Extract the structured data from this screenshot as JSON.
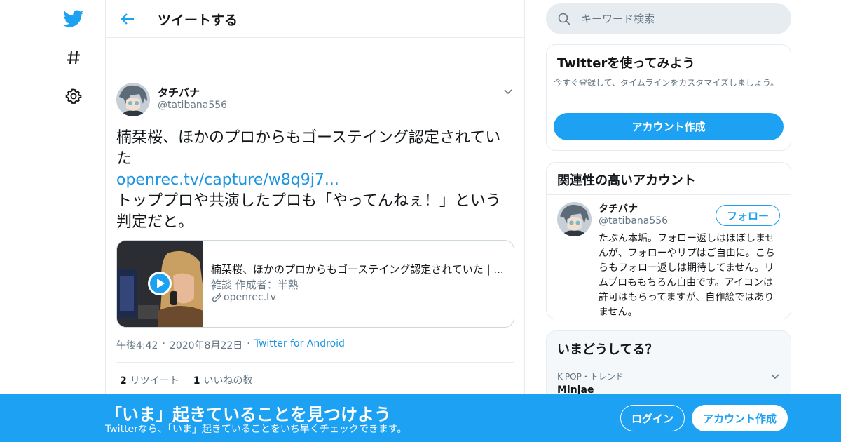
{
  "colors": {
    "accent": "#1da1f2",
    "link": "#1b95e0",
    "secondary_text": "#657786",
    "border": "#e6ecf0"
  },
  "nav": {
    "icons": [
      "twitter-bird-icon",
      "hashtag-icon",
      "gear-icon"
    ]
  },
  "header": {
    "title": "ツイートする"
  },
  "tweet": {
    "author_name": "タチバナ",
    "author_handle": "@tatibana556",
    "text_line1": "楠栞桜、ほかのプロからもゴーステイング認定されていた",
    "link": "openrec.tv/capture/w8q9j7...",
    "text_line2": "トッププロや共演したプロも「やってんねぇ！」という判定だと。",
    "card": {
      "title": "楠栞桜、ほかのプロからもゴーステイング認定されていた | ...",
      "description": "雑談 作成者：半熟",
      "domain": "openrec.tv"
    },
    "time": "午後4:42",
    "date": "2020年8月22日",
    "app": "Twitter for Android",
    "retweets_count": "2",
    "retweets_label": "リツイート",
    "likes_count": "1",
    "likes_label": "いいねの数"
  },
  "search": {
    "placeholder": "キーワード検索"
  },
  "signup_panel": {
    "title": "Twitterを使ってみよう",
    "text": "今すぐ登録して、タイムラインをカスタマイズしましょう。",
    "button": "アカウント作成"
  },
  "related_panel": {
    "title": "関連性の高いアカウント",
    "name": "タチバナ",
    "handle": "@tatibana556",
    "follow_button": "フォロー",
    "bio": "たぶん本垢。フォロー返しはほぼしませんが、フォローやリプはご自由に。こちらもフォロー返しは期待してません。リムブロももちろん自由です。アイコンは許可はもらってますが、自作絵ではありません。"
  },
  "trends_panel": {
    "title": "いまどうしてる？",
    "trend_meta": "K-POP・トレンド",
    "trend_name": "Minjae"
  },
  "bottom_bar": {
    "title": "「いま」起きていることを見つけよう",
    "subtitle": "Twitterなら、「いま」起きていることをいち早くチェックできます。",
    "login": "ログイン",
    "signup": "アカウント作成"
  }
}
